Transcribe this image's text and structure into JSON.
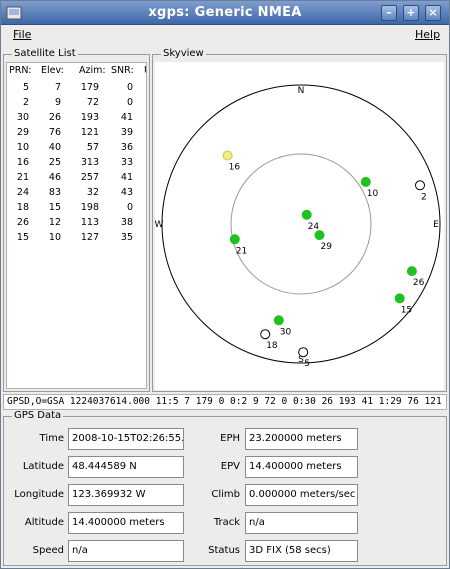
{
  "window": {
    "title": "xgps: Generic NMEA"
  },
  "menu": {
    "file_label": "File",
    "help_label": "Help"
  },
  "satellite_list": {
    "title": "Satellite List",
    "headers": [
      "PRN:",
      "Elev:",
      "Azim:",
      "SNR:",
      "U"
    ],
    "rows": [
      [
        "5",
        "7",
        "179",
        "0"
      ],
      [
        "2",
        "9",
        "72",
        "0"
      ],
      [
        "30",
        "26",
        "193",
        "41"
      ],
      [
        "29",
        "76",
        "121",
        "39"
      ],
      [
        "10",
        "40",
        "57",
        "36"
      ],
      [
        "16",
        "25",
        "313",
        "33"
      ],
      [
        "21",
        "46",
        "257",
        "41"
      ],
      [
        "24",
        "83",
        "32",
        "43"
      ],
      [
        "18",
        "15",
        "198",
        "0"
      ],
      [
        "26",
        "12",
        "113",
        "38"
      ],
      [
        "15",
        "10",
        "127",
        "35"
      ]
    ]
  },
  "skyview": {
    "title": "Skyview",
    "compass": {
      "n": "N",
      "s": "S",
      "e": "E",
      "w": "W"
    },
    "colors": {
      "used": "#1fc21f",
      "weak": "#f0f08a",
      "unused": "#ffffff"
    },
    "satellites": [
      {
        "prn": "5",
        "elev": 7,
        "azim": 179,
        "state": "unused"
      },
      {
        "prn": "2",
        "elev": 9,
        "azim": 72,
        "state": "unused"
      },
      {
        "prn": "30",
        "elev": 26,
        "azim": 193,
        "state": "used"
      },
      {
        "prn": "29",
        "elev": 76,
        "azim": 121,
        "state": "used"
      },
      {
        "prn": "10",
        "elev": 40,
        "azim": 57,
        "state": "used"
      },
      {
        "prn": "16",
        "elev": 25,
        "azim": 313,
        "state": "weak"
      },
      {
        "prn": "21",
        "elev": 46,
        "azim": 257,
        "state": "used"
      },
      {
        "prn": "24",
        "elev": 83,
        "azim": 32,
        "state": "used"
      },
      {
        "prn": "18",
        "elev": 15,
        "azim": 198,
        "state": "unused"
      },
      {
        "prn": "26",
        "elev": 12,
        "azim": 113,
        "state": "used"
      },
      {
        "prn": "15",
        "elev": 10,
        "azim": 127,
        "state": "used"
      }
    ]
  },
  "nmea_line": "GPSD,O=GSA 1224037614.000 11:5 7 179 0 0:2 9 72 0 0:30 26 193 41 1:29 76 121 40 1:10",
  "gps_data": {
    "title": "GPS Data",
    "time_label": "Time",
    "time_value": "2008-10-15T02:26:55.",
    "latitude_label": "Latitude",
    "latitude_value": "48.444589 N",
    "longitude_label": "Longitude",
    "longitude_value": "123.369932 W",
    "altitude_label": "Altitude",
    "altitude_value": "14.400000 meters",
    "speed_label": "Speed",
    "speed_value": "n/a",
    "eph_label": "EPH",
    "eph_value": "23.200000 meters",
    "epv_label": "EPV",
    "epv_value": "14.400000 meters",
    "climb_label": "Climb",
    "climb_value": "0.000000 meters/sec",
    "track_label": "Track",
    "track_value": "n/a",
    "status_label": "Status",
    "status_value": "3D FIX (58 secs)"
  }
}
